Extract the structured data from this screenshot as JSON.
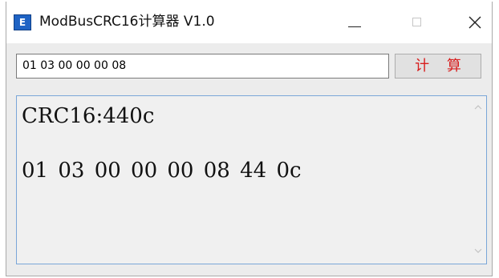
{
  "window": {
    "title": "ModBusCRC16计算器 V1.0",
    "icon_label": "E"
  },
  "controls": {
    "minimize": "minimize-icon",
    "maximize": "maximize-icon",
    "close": "close-icon"
  },
  "input": {
    "value": "01 03 00 00 00 08"
  },
  "calc_button": {
    "label": "计 算",
    "color": "#d81e1e"
  },
  "output": {
    "crc_line": "CRC16:440c",
    "result_line": "01 03 00 00 00 08 44 0c"
  },
  "colors": {
    "icon_blue": "#1f63c4",
    "output_border": "#7aa6d8"
  }
}
